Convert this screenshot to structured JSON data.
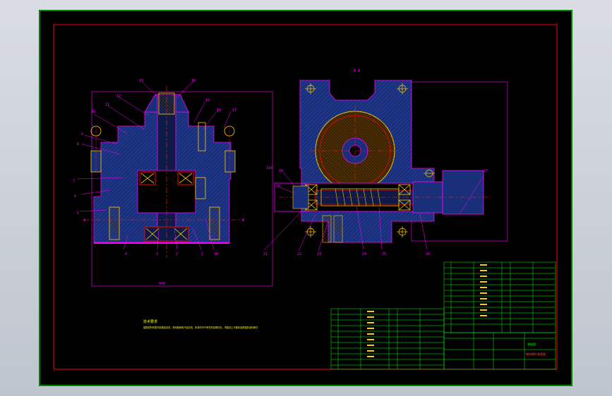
{
  "drawing": {
    "view_label_top": "A-A",
    "note_heading": "技术要求",
    "note_line": "装配前所有零件用煤油清洗，滚动轴承用汽油清洗，机体内不许有任何杂物存在，内壁涂上不被机油侵蚀的涂料两次",
    "section_marks": [
      "A",
      "A"
    ],
    "overall_dim_width": "490",
    "overall_dim_height": "310",
    "left_balloons": [
      "1",
      "2",
      "3",
      "4",
      "5",
      "6",
      "7",
      "8",
      "9",
      "10",
      "11",
      "12",
      "13",
      "14",
      "15",
      "16",
      "17",
      "18"
    ],
    "right_balloons": [
      "19",
      "20",
      "21",
      "22",
      "23",
      "24",
      "25",
      "26",
      "27"
    ],
    "title_block_name": "蜗轮蜗杆减速器",
    "title_block_label": "装配图"
  },
  "colors": {
    "background": "#000000",
    "frame_outer": "#00ff00",
    "frame_inner": "#ff0000",
    "body_fill": "#1a2f7a",
    "outline": "#ff00ff",
    "centerline": "#ff2020",
    "part_yellow": "#ffcc00",
    "table_text": "#00ff00"
  }
}
